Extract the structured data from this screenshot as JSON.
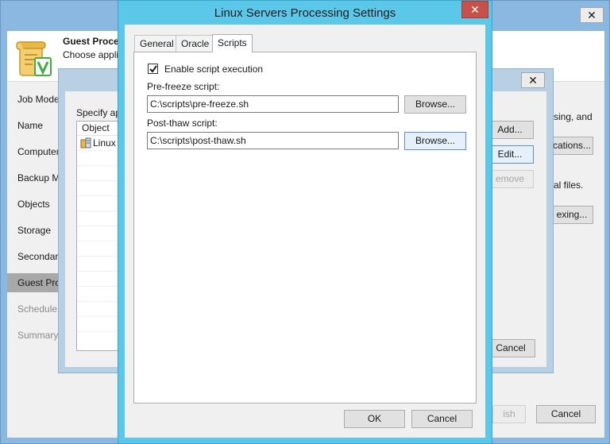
{
  "wizard": {
    "close_glyph": "✕",
    "header_title": "Guest Proces",
    "header_subtitle": "Choose appli",
    "sidebar": [
      {
        "label": "Job Mode",
        "state": "normal"
      },
      {
        "label": "Name",
        "state": "normal"
      },
      {
        "label": "Computer",
        "state": "normal"
      },
      {
        "label": "Backup M",
        "state": "normal"
      },
      {
        "label": "Objects",
        "state": "normal"
      },
      {
        "label": "Storage",
        "state": "normal"
      },
      {
        "label": "Secondary",
        "state": "normal"
      },
      {
        "label": "Guest Pro",
        "state": "selected"
      },
      {
        "label": "Schedule",
        "state": "dimmed"
      },
      {
        "label": "Summary",
        "state": "dimmed"
      }
    ],
    "right_text_1": "sing, and",
    "right_text_2": "al files.",
    "finish_label": "ish",
    "cancel_label": "Cancel",
    "icon": "scroll-checkmark-icon"
  },
  "app_settings": {
    "close_glyph": "✕",
    "specify_label": "Specify ap",
    "list_header": "Object",
    "list_items": [
      "Linux"
    ],
    "add_label": "Add...",
    "edit_label": "Edit...",
    "remove_label": "emove",
    "applications_label": "cations...",
    "indexing_label": "exing...",
    "cancel_label": "Cancel"
  },
  "dialog": {
    "title": "Linux Servers Processing Settings",
    "close_glyph": "✕",
    "tabs": [
      {
        "label": "General",
        "active": false
      },
      {
        "label": "Oracle",
        "active": false
      },
      {
        "label": "Scripts",
        "active": true
      }
    ],
    "enable_script_label": "Enable script execution",
    "enable_script_checked": true,
    "pre_freeze_label": "Pre-freeze script:",
    "pre_freeze_value": "C:\\scripts\\pre-freeze.sh",
    "post_thaw_label": "Post-thaw script:",
    "post_thaw_value": "C:\\scripts\\post-thaw.sh",
    "browse_label": "Browse...",
    "ok_label": "OK",
    "cancel_label": "Cancel"
  },
  "colors": {
    "active_frame": "#5bc8ea",
    "close_button": "#c7504a",
    "selected_sidebar": "#a8a8a8",
    "scroll_icon_green": "#3fae3f",
    "scroll_icon_gold": "#e9b84a"
  }
}
